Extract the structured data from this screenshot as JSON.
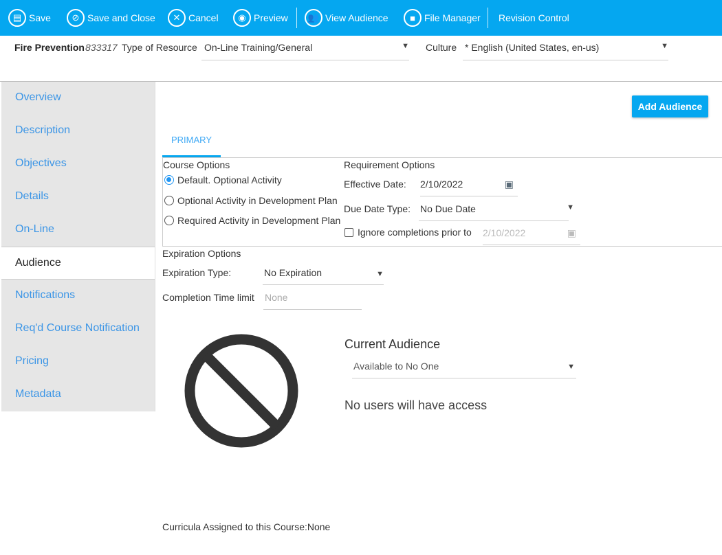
{
  "toolbar": {
    "save": "Save",
    "save_close": "Save and Close",
    "cancel": "Cancel",
    "preview": "Preview",
    "view_audience": "View Audience",
    "file_manager": "File Manager",
    "revision_control": "Revision Control"
  },
  "header": {
    "title": "Fire Prevention",
    "id": "833317",
    "type_label": "Type of Resource",
    "type_value": "On-Line Training/General",
    "culture_label": "Culture",
    "culture_value": "* English (United States, en-us)"
  },
  "sidebar": {
    "items": [
      {
        "label": "Overview"
      },
      {
        "label": "Description"
      },
      {
        "label": "Objectives"
      },
      {
        "label": "Details"
      },
      {
        "label": "On-Line"
      },
      {
        "label": "Audience"
      },
      {
        "label": "Notifications"
      },
      {
        "label": "Req'd Course Notification"
      },
      {
        "label": "Pricing"
      },
      {
        "label": "Metadata"
      }
    ]
  },
  "main": {
    "add_audience": "Add Audience",
    "tab": "PRIMARY",
    "course_options": {
      "title": "Course Options",
      "options": [
        "Default. Optional Activity",
        "Optional Activity in Development Plan",
        "Required Activity in Development Plan"
      ],
      "selected": 0
    },
    "requirement": {
      "title": "Requirement Options",
      "effective_label": "Effective Date:",
      "effective_value": "2/10/2022",
      "due_label": "Due Date Type:",
      "due_value": "No Due Date",
      "ignore_label": "Ignore completions prior to",
      "ignore_value": "2/10/2022"
    },
    "expiration": {
      "title": "Expiration Options",
      "type_label": "Expiration Type:",
      "type_value": "No Expiration",
      "limit_label": "Completion Time limit",
      "limit_placeholder": "None"
    },
    "audience": {
      "title": "Current Audience",
      "value": "Available to No One",
      "message": "No users will have access"
    },
    "curricula": "Curricula Assigned to this Course:None"
  }
}
